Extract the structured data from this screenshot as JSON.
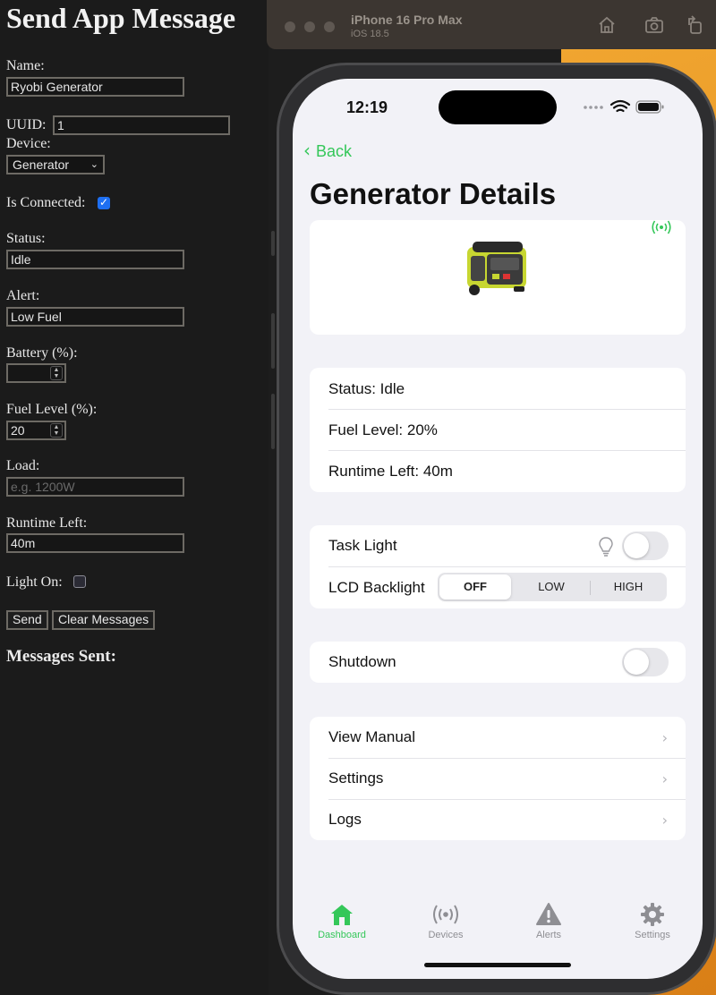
{
  "form": {
    "title": "Send App Message",
    "name_label": "Name:",
    "name_value": "Ryobi Generator",
    "uuid_label": "UUID:",
    "uuid_value": "1",
    "device_label": "Device:",
    "device_value": "Generator",
    "connected_label": "Is Connected:",
    "connected_checked": true,
    "status_label": "Status:",
    "status_value": "Idle",
    "alert_label": "Alert:",
    "alert_value": "Low Fuel",
    "battery_label": "Battery (%):",
    "battery_value": "",
    "fuel_label": "Fuel Level (%):",
    "fuel_value": "20",
    "load_label": "Load:",
    "load_placeholder": "e.g. 1200W",
    "runtime_label": "Runtime Left:",
    "runtime_value": "40m",
    "light_label": "Light On:",
    "light_checked": false,
    "send_label": "Send",
    "clear_label": "Clear Messages",
    "messages_heading": "Messages Sent:"
  },
  "simulator": {
    "device_name": "iPhone 16 Pro Max",
    "os_version": "iOS 18.5"
  },
  "app": {
    "time": "12:19",
    "back_label": "Back",
    "page_title": "Generator Details",
    "accent_color": "#34c759",
    "status_rows": [
      "Status: Idle",
      "Fuel Level: 20%",
      "Runtime Left: 40m"
    ],
    "task_light_label": "Task Light",
    "task_light_on": false,
    "lcd_label": "LCD Backlight",
    "lcd_options": [
      "OFF",
      "LOW",
      "HIGH"
    ],
    "lcd_selected": "OFF",
    "shutdown_label": "Shutdown",
    "shutdown_on": false,
    "links": [
      "View Manual",
      "Settings",
      "Logs"
    ],
    "tabs": [
      {
        "label": "Dashboard",
        "icon": "house-icon",
        "active": true
      },
      {
        "label": "Devices",
        "icon": "radio-waves-icon",
        "active": false
      },
      {
        "label": "Alerts",
        "icon": "warning-triangle-icon",
        "active": false
      },
      {
        "label": "Settings",
        "icon": "gear-icon",
        "active": false
      }
    ]
  }
}
